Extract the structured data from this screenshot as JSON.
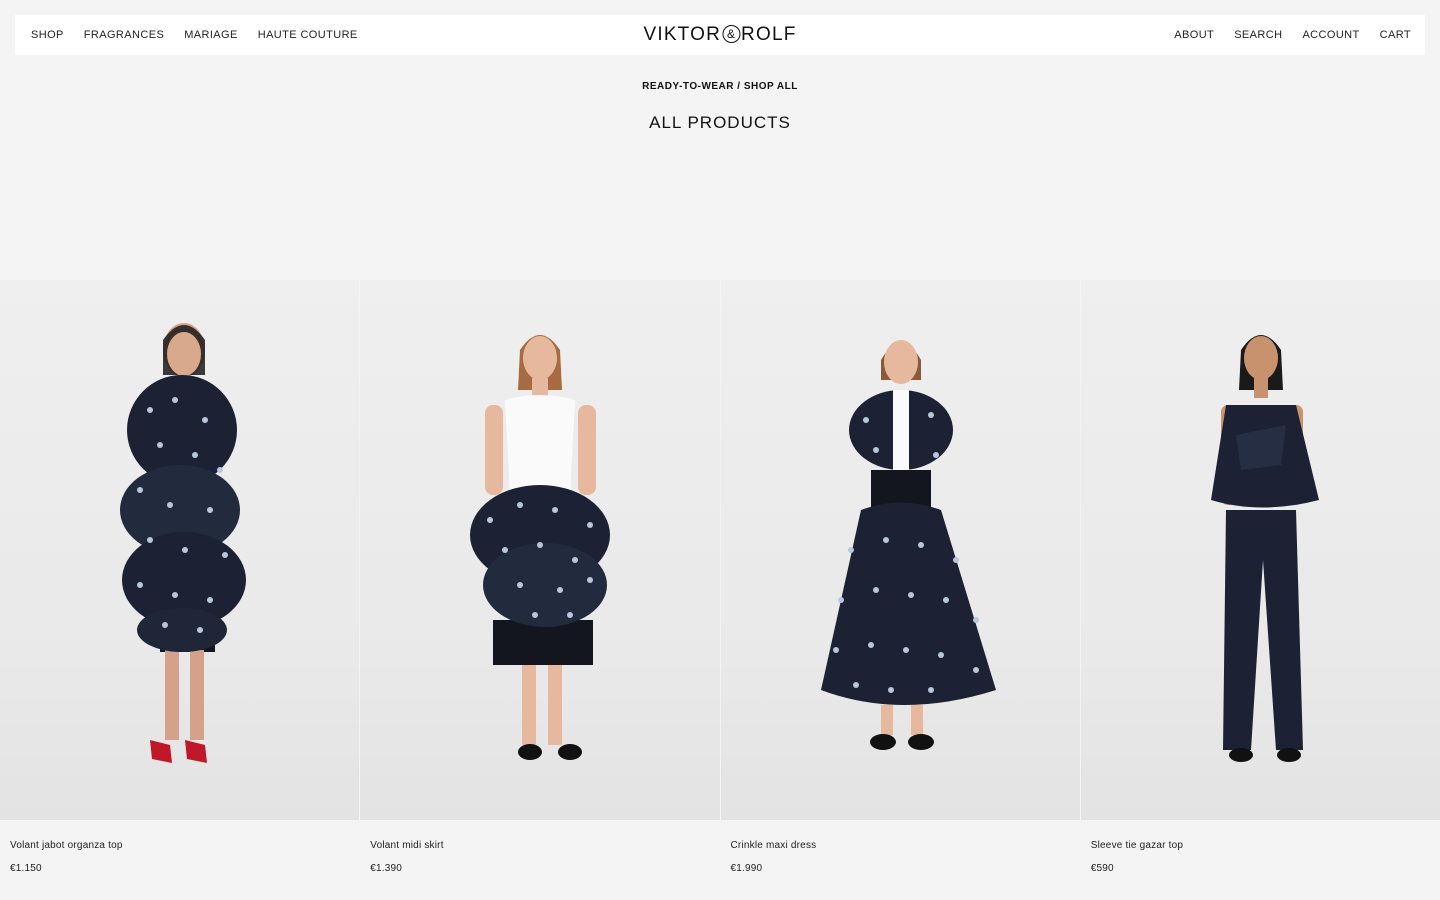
{
  "header": {
    "nav_left": [
      "SHOP",
      "FRAGRANCES",
      "MARIAGE",
      "HAUTE COUTURE"
    ],
    "logo_left": "VIKTOR",
    "logo_amp": "&",
    "logo_right": "ROLF",
    "nav_right": [
      "ABOUT",
      "SEARCH",
      "ACCOUNT",
      "CART"
    ]
  },
  "breadcrumb": {
    "parent": "READY-TO-WEAR",
    "separator": " / ",
    "current": "SHOP ALL"
  },
  "page_title": "ALL PRODUCTS",
  "products": [
    {
      "name": "Volant jabot organza top",
      "price": "€1.150"
    },
    {
      "name": "Volant midi skirt",
      "price": "€1.390"
    },
    {
      "name": "Crinkle maxi dress",
      "price": "€1.990"
    },
    {
      "name": "Sleeve tie gazar top",
      "price": "€590"
    }
  ],
  "colors": {
    "background": "#f4f4f4",
    "header_bg": "#ffffff",
    "garment_navy": "#1c2233",
    "skin": "#d9a98c"
  }
}
